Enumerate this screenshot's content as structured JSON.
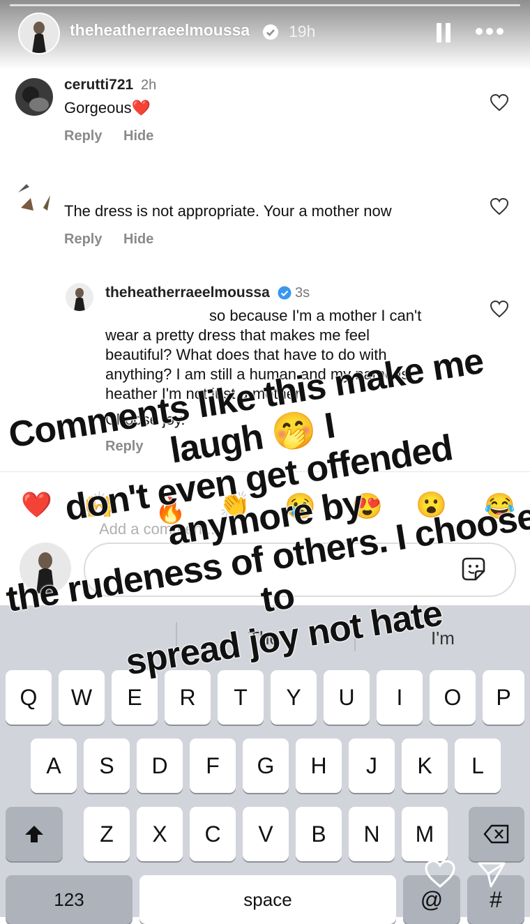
{
  "story_header": {
    "username": "theheatherraeelmoussa",
    "time": "19h"
  },
  "comments": [
    {
      "username": "cerutti721",
      "time": "2h",
      "text": "Gorgeous❤️",
      "reply_label": "Reply",
      "hide_label": "Hide"
    },
    {
      "username": "",
      "time": "",
      "text": "The dress is not appropriate. Your a mother now",
      "reply_label": "Reply",
      "hide_label": "Hide"
    }
  ],
  "reply": {
    "username": "theheatherraeelmoussa",
    "time": "3s",
    "lines": [
      "so because I'm a mother I can't",
      "wear a pretty dress that makes me feel",
      "beautiful? What does that have to do with",
      "anything? I am still a human and my name is",
      "heather I'm not just a mother."
    ],
    "closing": "Choose joy.",
    "reply_label": "Reply"
  },
  "emoji_bar": [
    "❤️",
    "🙌",
    "🔥",
    "👏",
    "😢",
    "😍",
    "😮",
    "😂"
  ],
  "comment_input": {
    "placeholder": "Add a comment..."
  },
  "keyboard": {
    "suggestions": [
      "",
      "The",
      "I'm"
    ],
    "row1": [
      "Q",
      "W",
      "E",
      "R",
      "T",
      "Y",
      "U",
      "I",
      "O",
      "P"
    ],
    "row2": [
      "A",
      "S",
      "D",
      "F",
      "G",
      "H",
      "J",
      "K",
      "L"
    ],
    "row3": [
      "Z",
      "X",
      "C",
      "V",
      "B",
      "N",
      "M"
    ],
    "numbers_label": "123",
    "space_label": "space",
    "at_label": "@",
    "hash_label": "#"
  },
  "overlay": {
    "lines": [
      "Comments like this make me laugh 🤭 I",
      "don't even get offended anymore by",
      "the rudeness of others. I choose to",
      "spread joy not hate"
    ]
  },
  "colors": {
    "verified_blue": "#3897f0",
    "keyboard_bg": "#d1d4da",
    "emoji_heart": "#e0282e"
  }
}
